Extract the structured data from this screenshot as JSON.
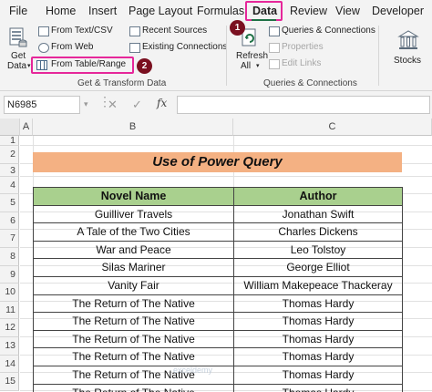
{
  "ribbon": {
    "tabs": [
      "File",
      "Home",
      "Insert",
      "Page Layout",
      "Formulas",
      "Data",
      "Review",
      "View",
      "Developer"
    ],
    "active_tab": "Data",
    "get_data": {
      "line1": "Get",
      "line2": "Data"
    },
    "from_text_csv": "From Text/CSV",
    "from_web": "From Web",
    "from_table_range": "From Table/Range",
    "recent_sources": "Recent Sources",
    "existing_connections": "Existing Connections",
    "group_get_transform": "Get & Transform Data",
    "refresh": {
      "line1": "Refresh",
      "line2": "All"
    },
    "queries_connections": "Queries & Connections",
    "properties": "Properties",
    "edit_links": "Edit Links",
    "group_queries": "Queries & Connections",
    "stocks": "Stocks",
    "badges": [
      "1",
      "2"
    ]
  },
  "formula_bar": {
    "name_box": "N6985",
    "fx": "fx",
    "formula": ""
  },
  "sheet": {
    "columns": [
      "A",
      "B",
      "C"
    ],
    "rows": [
      "1",
      "2",
      "3",
      "4",
      "5",
      "6",
      "7",
      "8",
      "9",
      "10",
      "11",
      "12",
      "13",
      "14",
      "15"
    ],
    "title": "Use of Power Query",
    "table": {
      "headers": [
        "Novel Name",
        "Author"
      ],
      "rows": [
        [
          "Guilliver Travels",
          "Jonathan Swift"
        ],
        [
          "A Tale of the Two Cities",
          "Charles Dickens"
        ],
        [
          "War and Peace",
          "Leo Tolstoy"
        ],
        [
          "Silas Mariner",
          "George Elliot"
        ],
        [
          "Vanity Fair",
          "William Makepeace Thackeray"
        ],
        [
          "The Return of The Native",
          "Thomas Hardy"
        ],
        [
          "The Return of The Native",
          "Thomas Hardy"
        ],
        [
          "The Return of The Native",
          "Thomas Hardy"
        ],
        [
          "The Return of The Native",
          "Thomas Hardy"
        ],
        [
          "The Return of The Native",
          "Thomas Hardy"
        ],
        [
          "The Return of The Native",
          "Thomas Hardy"
        ]
      ]
    }
  },
  "watermark": "exceldemy"
}
